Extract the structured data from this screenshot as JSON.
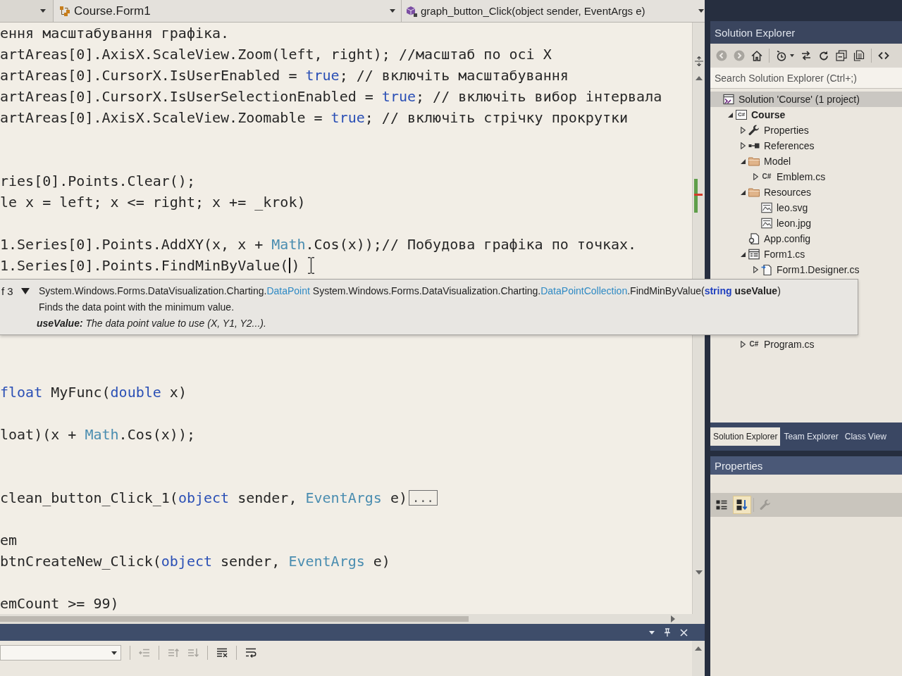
{
  "editor": {
    "nav_bar": {
      "type_dropdown": "Course.Form1",
      "member_dropdown": "graph_button_Click(object sender, EventArgs e)"
    },
    "lines": [
      {
        "kind": "code",
        "segments": [
          {
            "text": "ення масштабування графіка.",
            "kind": "plain"
          }
        ]
      },
      {
        "kind": "code",
        "segments": [
          {
            "text": "artAreas[0].AxisX.ScaleView.Zoom(left, right); //масштаб по осі X",
            "kind": "plain"
          }
        ]
      },
      {
        "kind": "code",
        "segments": [
          {
            "text": "artAreas[0].CursorX.IsUserEnabled = ",
            "kind": "plain"
          },
          {
            "text": "true",
            "kind": "keyword"
          },
          {
            "text": "; // включіть масштабування",
            "kind": "plain"
          }
        ]
      },
      {
        "kind": "code",
        "segments": [
          {
            "text": "artAreas[0].CursorX.IsUserSelectionEnabled = ",
            "kind": "plain"
          },
          {
            "text": "true",
            "kind": "keyword"
          },
          {
            "text": "; // включіть вибор інтервала",
            "kind": "plain"
          }
        ]
      },
      {
        "kind": "code",
        "segments": [
          {
            "text": "artAreas[0].AxisX.ScaleView.Zoomable = ",
            "kind": "plain"
          },
          {
            "text": "true",
            "kind": "keyword"
          },
          {
            "text": "; // включіть стрічку прокрутки",
            "kind": "plain"
          }
        ]
      },
      {
        "kind": "blank"
      },
      {
        "kind": "blank"
      },
      {
        "kind": "code",
        "segments": [
          {
            "text": "ries[0].Points.Clear();",
            "kind": "plain"
          }
        ]
      },
      {
        "kind": "code",
        "segments": [
          {
            "text": "le x = left; x <= right; x += _krok)",
            "kind": "plain"
          }
        ]
      },
      {
        "kind": "blank"
      },
      {
        "kind": "code",
        "segments": [
          {
            "text": "1.Series[0].Points.AddXY(x, x + ",
            "kind": "plain"
          },
          {
            "text": "Math",
            "kind": "type"
          },
          {
            "text": ".Cos(x));// Побудова графіка по точках.",
            "kind": "plain"
          }
        ]
      },
      {
        "kind": "code",
        "segments": [
          {
            "text": "1.Series[0].Points.FindMinByValue(",
            "kind": "plain"
          },
          {
            "kind": "caret"
          },
          {
            "text": ")",
            "kind": "plain"
          },
          {
            "kind": "pointer"
          }
        ]
      },
      {
        "kind": "blank"
      },
      {
        "kind": "blank"
      },
      {
        "kind": "blank"
      },
      {
        "kind": "blank"
      },
      {
        "kind": "blank"
      },
      {
        "kind": "code",
        "segments": [
          {
            "text": "float",
            "kind": "keyword"
          },
          {
            "text": " MyFunc(",
            "kind": "plain"
          },
          {
            "text": "double",
            "kind": "keyword"
          },
          {
            "text": " x)",
            "kind": "plain"
          }
        ]
      },
      {
        "kind": "blank"
      },
      {
        "kind": "code",
        "segments": [
          {
            "text": "loat)(x + ",
            "kind": "plain"
          },
          {
            "text": "Math",
            "kind": "type"
          },
          {
            "text": ".Cos(x));",
            "kind": "plain"
          }
        ]
      },
      {
        "kind": "blank"
      },
      {
        "kind": "blank"
      },
      {
        "kind": "code",
        "segments": [
          {
            "text": "clean_button_Click_1(",
            "kind": "plain"
          },
          {
            "text": "object",
            "kind": "keyword"
          },
          {
            "text": " sender, ",
            "kind": "plain"
          },
          {
            "text": "EventArgs",
            "kind": "type"
          },
          {
            "text": " e)",
            "kind": "plain"
          },
          {
            "text": "...",
            "kind": "collapsed"
          }
        ]
      },
      {
        "kind": "blank"
      },
      {
        "kind": "code",
        "segments": [
          {
            "text": "em",
            "kind": "plain"
          }
        ]
      },
      {
        "kind": "code",
        "segments": [
          {
            "text": "btnCreateNew_Click(",
            "kind": "plain"
          },
          {
            "text": "object",
            "kind": "keyword"
          },
          {
            "text": " sender, ",
            "kind": "plain"
          },
          {
            "text": "EventArgs",
            "kind": "type"
          },
          {
            "text": " e)",
            "kind": "plain"
          }
        ]
      },
      {
        "kind": "blank"
      },
      {
        "kind": "code",
        "segments": [
          {
            "text": "emCount >= 99)",
            "kind": "plain"
          }
        ]
      }
    ]
  },
  "tooltip": {
    "overload": "f 3",
    "signature": [
      {
        "text": "System.Windows.Forms.DataVisualization.Charting.",
        "kind": "plain"
      },
      {
        "text": "DataPoint",
        "kind": "type"
      },
      {
        "text": " System.Windows.Forms.DataVisualization.Charting.",
        "kind": "plain"
      },
      {
        "text": "DataPointCollection",
        "kind": "type"
      },
      {
        "text": ".FindMinByValue(",
        "kind": "plain"
      },
      {
        "text": "string",
        "kind": "keyword"
      },
      {
        "text": " useValue",
        "kind": "param"
      },
      {
        "text": ")",
        "kind": "plain"
      }
    ],
    "summary": "Finds the data point with the minimum value.",
    "parameter": "**useValue:** The data point value to use (X, Y1, Y2...)."
  },
  "output_panel": {
    "toolbar": [
      [
        {
          "kind": "find",
          "disabled": true
        }
      ],
      [
        {
          "kind": "previous",
          "disabled": true
        },
        {
          "kind": "next",
          "disabled": true
        }
      ],
      [
        {
          "kind": "clear-all",
          "disabled": false
        }
      ],
      [
        {
          "kind": "word-wrap",
          "disabled": false
        }
      ]
    ]
  },
  "solution_explorer": {
    "title": "Solution Explorer",
    "toolbar": [
      [
        {
          "kind": "back",
          "disabled": true
        },
        {
          "kind": "forward",
          "disabled": true
        },
        {
          "kind": "home",
          "disabled": false
        }
      ],
      [
        {
          "kind": "pending-changes",
          "disabled": false
        },
        {
          "kind": "sync",
          "disabled": false
        },
        {
          "kind": "refresh",
          "disabled": false
        },
        {
          "kind": "collapse-all",
          "disabled": false
        },
        {
          "kind": "show-all-files",
          "disabled": false
        }
      ],
      [
        {
          "kind": "code-view",
          "disabled": false
        }
      ]
    ],
    "search": {
      "placeholder": "Search Solution Explorer (Ctrl+;)"
    },
    "tree": [
      {
        "label": "Solution 'Course' (1 project)",
        "kind": "solution",
        "selected": true,
        "bold": false,
        "children": [
          {
            "label": "Course",
            "kind": "csharp-project",
            "icon_text": "C#",
            "expanded": true,
            "selected": false,
            "bold": true,
            "children": [
              {
                "label": "Properties",
                "kind": "wrench",
                "expanded": false,
                "selected": false,
                "bold": false
              },
              {
                "label": "References",
                "kind": "references",
                "expanded": false,
                "selected": false,
                "bold": false
              },
              {
                "label": "Model",
                "kind": "folder",
                "expanded": true,
                "selected": false,
                "bold": false,
                "children": [
                  {
                    "label": "Emblem.cs",
                    "kind": "csharp-file",
                    "icon_text": "C#",
                    "expanded": false,
                    "selected": false,
                    "bold": false
                  }
                ]
              },
              {
                "label": "Resources",
                "kind": "folder",
                "expanded": true,
                "selected": false,
                "bold": false,
                "children": [
                  {
                    "label": "leo.svg",
                    "kind": "image",
                    "selected": false,
                    "bold": false
                  },
                  {
                    "label": "leon.jpg",
                    "kind": "image",
                    "selected": false,
                    "bold": false
                  }
                ]
              },
              {
                "label": "App.config",
                "kind": "config",
                "selected": false,
                "bold": false
              },
              {
                "label": "Form1.cs",
                "kind": "form",
                "expanded": true,
                "selected": false,
                "bold": false,
                "children": [
                  {
                    "label": "Form1.Designer.cs",
                    "kind": "designer",
                    "expanded": false,
                    "selected": false,
                    "bold": false
                  }
                ]
              },
              {
                "label": "Program.cs",
                "kind": "csharp-file",
                "icon_text": "C#",
                "expanded": false,
                "selected": false,
                "bold": false
              }
            ]
          }
        ]
      }
    ],
    "tabs": [
      {
        "label": "Solution Explorer",
        "selected": true
      },
      {
        "label": "Team Explorer",
        "selected": false
      },
      {
        "label": "Class View",
        "selected": false
      }
    ]
  },
  "properties": {
    "title": "Properties",
    "toolbar": [
      [
        {
          "kind": "categorized",
          "selected": false,
          "disabled": false
        },
        {
          "kind": "alphabetical",
          "selected": true,
          "disabled": false
        }
      ],
      [
        {
          "kind": "property-pages",
          "selected": false,
          "disabled": true
        }
      ]
    ]
  }
}
